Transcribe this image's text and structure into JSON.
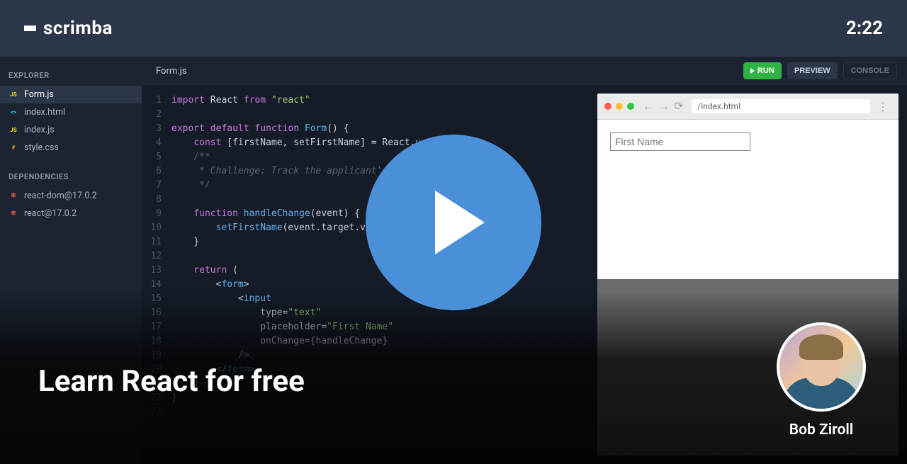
{
  "header": {
    "brand": "scrimba",
    "timestamp": "2:22"
  },
  "sidebar": {
    "explorer_heading": "EXPLORER",
    "files": [
      {
        "name": "Form.js",
        "type": "js",
        "active": true
      },
      {
        "name": "index.html",
        "type": "html",
        "active": false
      },
      {
        "name": "index.js",
        "type": "js",
        "active": false
      },
      {
        "name": "style.css",
        "type": "css",
        "active": false
      }
    ],
    "dependencies_heading": "DEPENDENCIES",
    "dependencies": [
      {
        "name": "react-dom@17.0.2"
      },
      {
        "name": "react@17.0.2"
      }
    ]
  },
  "tabbar": {
    "active_file": "Form.js",
    "run_label": "RUN",
    "preview_label": "PREVIEW",
    "console_label": "CONSOLE"
  },
  "code": {
    "lines": [
      {
        "n": 1,
        "segs": [
          [
            "kw",
            "import"
          ],
          [
            "op",
            " React "
          ],
          [
            "kw",
            "from"
          ],
          [
            "op",
            " "
          ],
          [
            "str",
            "\"react\""
          ]
        ]
      },
      {
        "n": 2,
        "segs": []
      },
      {
        "n": 3,
        "segs": [
          [
            "kw",
            "export"
          ],
          [
            "op",
            " "
          ],
          [
            "kw",
            "default"
          ],
          [
            "op",
            " "
          ],
          [
            "kw",
            "function"
          ],
          [
            "op",
            " "
          ],
          [
            "fn",
            "Form"
          ],
          [
            "op",
            "() {"
          ]
        ]
      },
      {
        "n": 4,
        "segs": [
          [
            "op",
            "    "
          ],
          [
            "kw",
            "const"
          ],
          [
            "op",
            " [firstName, setFirstName] = React."
          ],
          [
            "fn",
            "useState"
          ],
          [
            "op",
            "("
          ],
          [
            "str",
            "\"\""
          ],
          [
            "op",
            ")"
          ]
        ]
      },
      {
        "n": 5,
        "segs": [
          [
            "op",
            "    "
          ],
          [
            "cm",
            "/**"
          ]
        ]
      },
      {
        "n": 6,
        "segs": [
          [
            "op",
            "    "
          ],
          [
            "cm",
            " * Challenge: Track the applicant's last name as well"
          ]
        ]
      },
      {
        "n": 7,
        "segs": [
          [
            "op",
            "    "
          ],
          [
            "cm",
            " */"
          ]
        ]
      },
      {
        "n": 8,
        "segs": []
      },
      {
        "n": 9,
        "segs": [
          [
            "op",
            "    "
          ],
          [
            "kw",
            "function"
          ],
          [
            "op",
            " "
          ],
          [
            "fn",
            "handleChange"
          ],
          [
            "op",
            "(event) {"
          ]
        ]
      },
      {
        "n": 10,
        "segs": [
          [
            "op",
            "        "
          ],
          [
            "fn",
            "setFirstName"
          ],
          [
            "op",
            "(event.target.value)"
          ]
        ]
      },
      {
        "n": 11,
        "segs": [
          [
            "op",
            "    }"
          ]
        ]
      },
      {
        "n": 12,
        "segs": []
      },
      {
        "n": 13,
        "segs": [
          [
            "op",
            "    "
          ],
          [
            "kw",
            "return"
          ],
          [
            "op",
            " ("
          ]
        ]
      },
      {
        "n": 14,
        "segs": [
          [
            "op",
            "        <"
          ],
          [
            "fn",
            "form"
          ],
          [
            "op",
            ">"
          ]
        ]
      },
      {
        "n": 15,
        "segs": [
          [
            "op",
            "            <"
          ],
          [
            "fn",
            "input"
          ]
        ]
      },
      {
        "n": 16,
        "segs": [
          [
            "op",
            "                type="
          ],
          [
            "str",
            "\"text\""
          ]
        ]
      },
      {
        "n": 17,
        "segs": [
          [
            "op",
            "                placeholder="
          ],
          [
            "str",
            "\"First Name\""
          ]
        ]
      },
      {
        "n": 18,
        "segs": [
          [
            "op",
            "                onChange={handleChange}"
          ]
        ]
      },
      {
        "n": 19,
        "segs": [
          [
            "op",
            "            />"
          ]
        ]
      },
      {
        "n": 20,
        "segs": [
          [
            "op",
            "        </"
          ],
          [
            "fn",
            "form"
          ],
          [
            "op",
            ">"
          ]
        ]
      },
      {
        "n": 21,
        "segs": [
          [
            "op",
            "    )"
          ]
        ]
      },
      {
        "n": 22,
        "segs": [
          [
            "op",
            "}"
          ]
        ]
      },
      {
        "n": 23,
        "segs": []
      }
    ]
  },
  "preview": {
    "url": "/index.html",
    "input_placeholder": "First Name"
  },
  "overlay": {
    "course_title": "Learn React for free",
    "instructor_name": "Bob Ziroll"
  }
}
